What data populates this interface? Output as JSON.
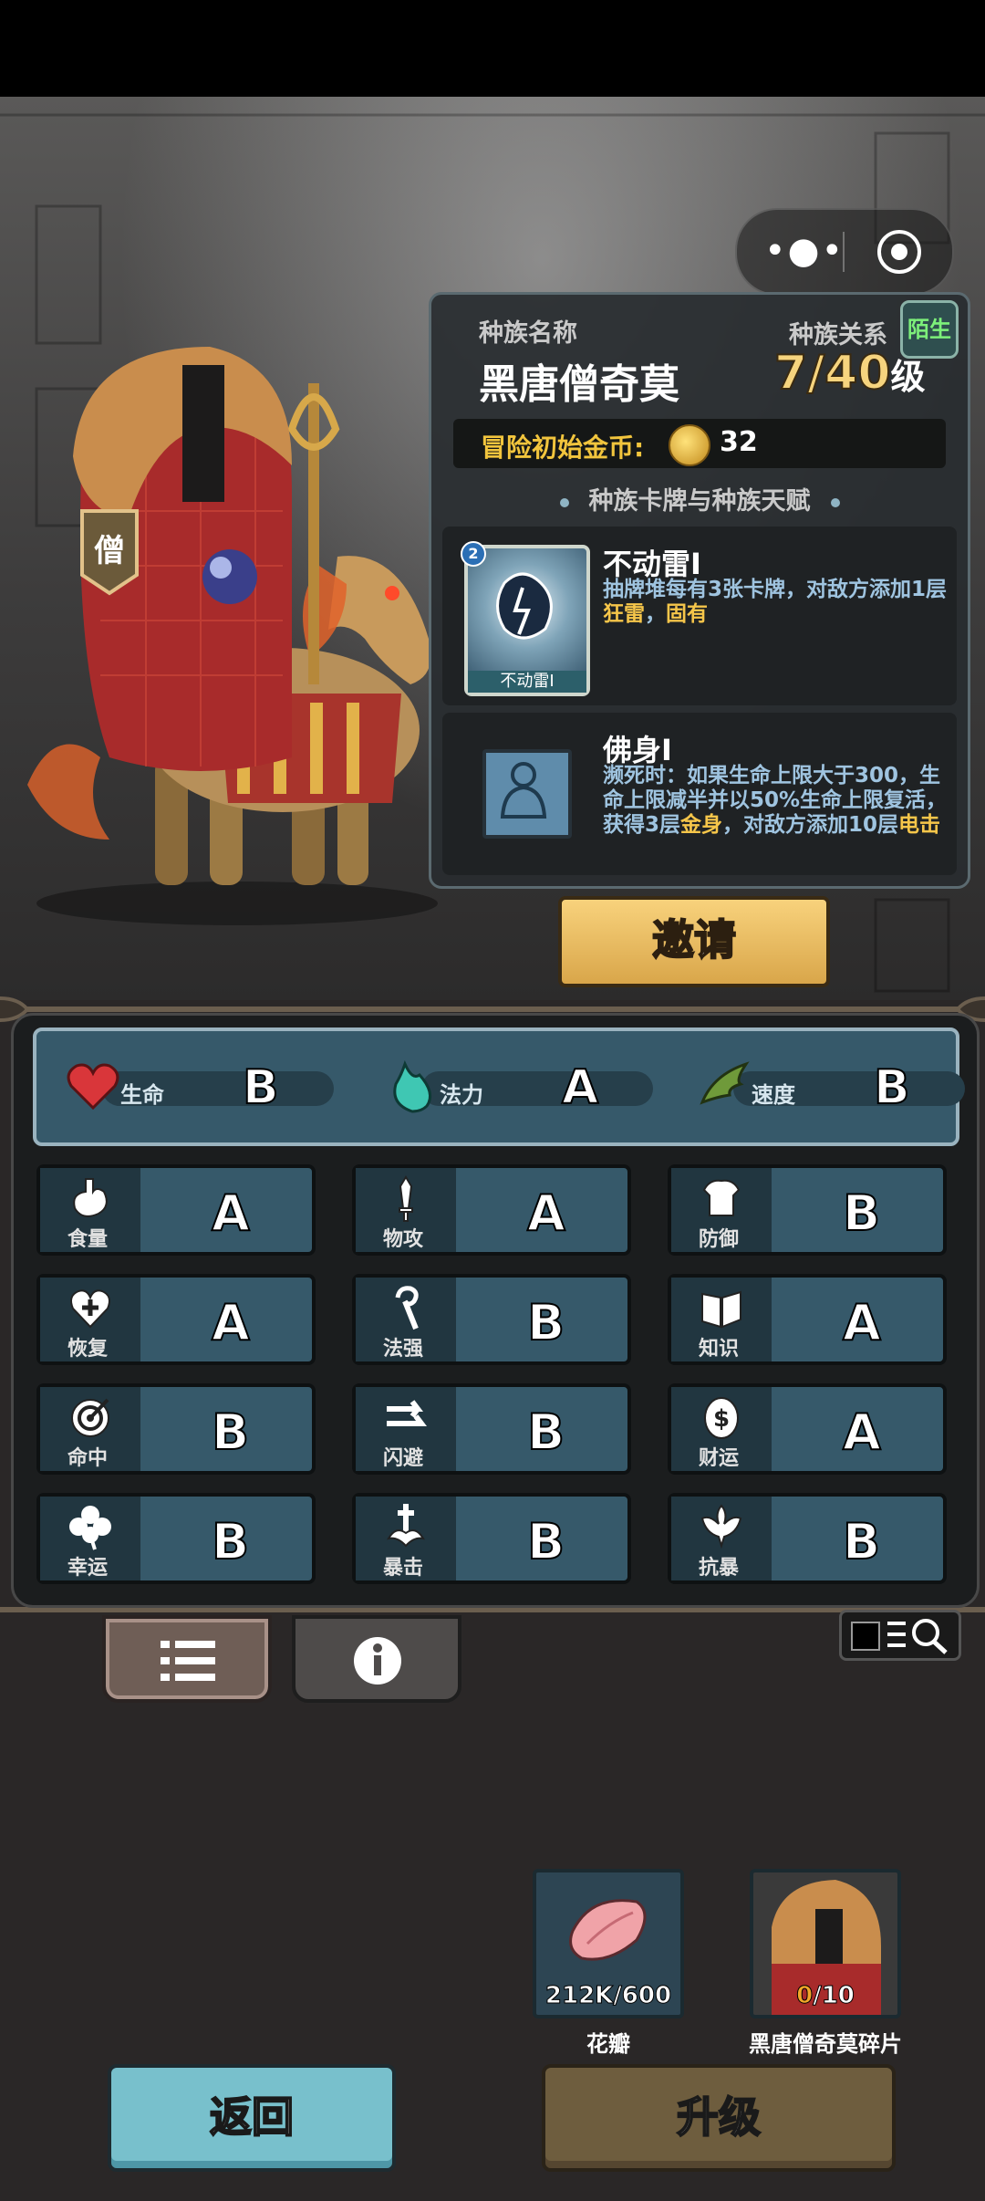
{
  "race": {
    "name_label": "种族名称",
    "name": "黑唐僧奇莫",
    "relation_label": "种族关系",
    "relation": "陌生",
    "level": "7/40",
    "level_unit": "级",
    "gold_label": "冒险初始金币:",
    "gold_value": "32",
    "hero_badge": "僧"
  },
  "section_title": "种族卡牌与种族天赋",
  "card": {
    "cost": "2",
    "thumb_caption": "不动雷I",
    "name": "不动雷I",
    "desc_1": "抽牌堆每有3张卡牌，对敌方添加1层",
    "desc_hl_1": "狂雷",
    "desc_2": "，",
    "desc_hl_2": "固有"
  },
  "talent": {
    "name": "佛身I",
    "desc_1": "濒死时：如果生命上限大于300，生命上限减半并以50%生命上限复活，获得3层",
    "desc_hl_1": "金身",
    "desc_2": "，对敌方添加10层",
    "desc_hl_2": "电击"
  },
  "invite_label": "邀请",
  "main_stats": [
    {
      "name": "生命",
      "grade": "B",
      "icon": "heart-icon"
    },
    {
      "name": "法力",
      "grade": "A",
      "icon": "flame-icon"
    },
    {
      "name": "速度",
      "grade": "B",
      "icon": "wing-icon"
    }
  ],
  "sub_stats": [
    {
      "name": "食量",
      "grade": "A",
      "icon": "stomach-icon"
    },
    {
      "name": "物攻",
      "grade": "A",
      "icon": "sword-icon"
    },
    {
      "name": "防御",
      "grade": "B",
      "icon": "armor-icon"
    },
    {
      "name": "恢复",
      "grade": "A",
      "icon": "heart-plus-icon"
    },
    {
      "name": "法强",
      "grade": "B",
      "icon": "staff-icon"
    },
    {
      "name": "知识",
      "grade": "A",
      "icon": "book-icon"
    },
    {
      "name": "命中",
      "grade": "B",
      "icon": "target-icon"
    },
    {
      "name": "闪避",
      "grade": "B",
      "icon": "dodge-arrows-icon"
    },
    {
      "name": "财运",
      "grade": "A",
      "icon": "coin-icon"
    },
    {
      "name": "幸运",
      "grade": "B",
      "icon": "clover-icon"
    },
    {
      "name": "暴击",
      "grade": "B",
      "icon": "crit-sword-icon"
    },
    {
      "name": "抗暴",
      "grade": "B",
      "icon": "shield-flower-icon"
    }
  ],
  "items": [
    {
      "label": "花瓣",
      "count": "212K/600",
      "icon": "petal-icon"
    },
    {
      "label": "黑唐僧奇莫碎片",
      "count_owned": "0",
      "count_need": "/10",
      "icon": "hero-fragment-icon"
    }
  ],
  "back_label": "返回",
  "upgrade_label": "升级",
  "colors": {
    "accent_gold": "#f6d47e",
    "panel_teal": "#36596a",
    "highlight": "#f6c64a",
    "relation_green": "#7df07a"
  }
}
